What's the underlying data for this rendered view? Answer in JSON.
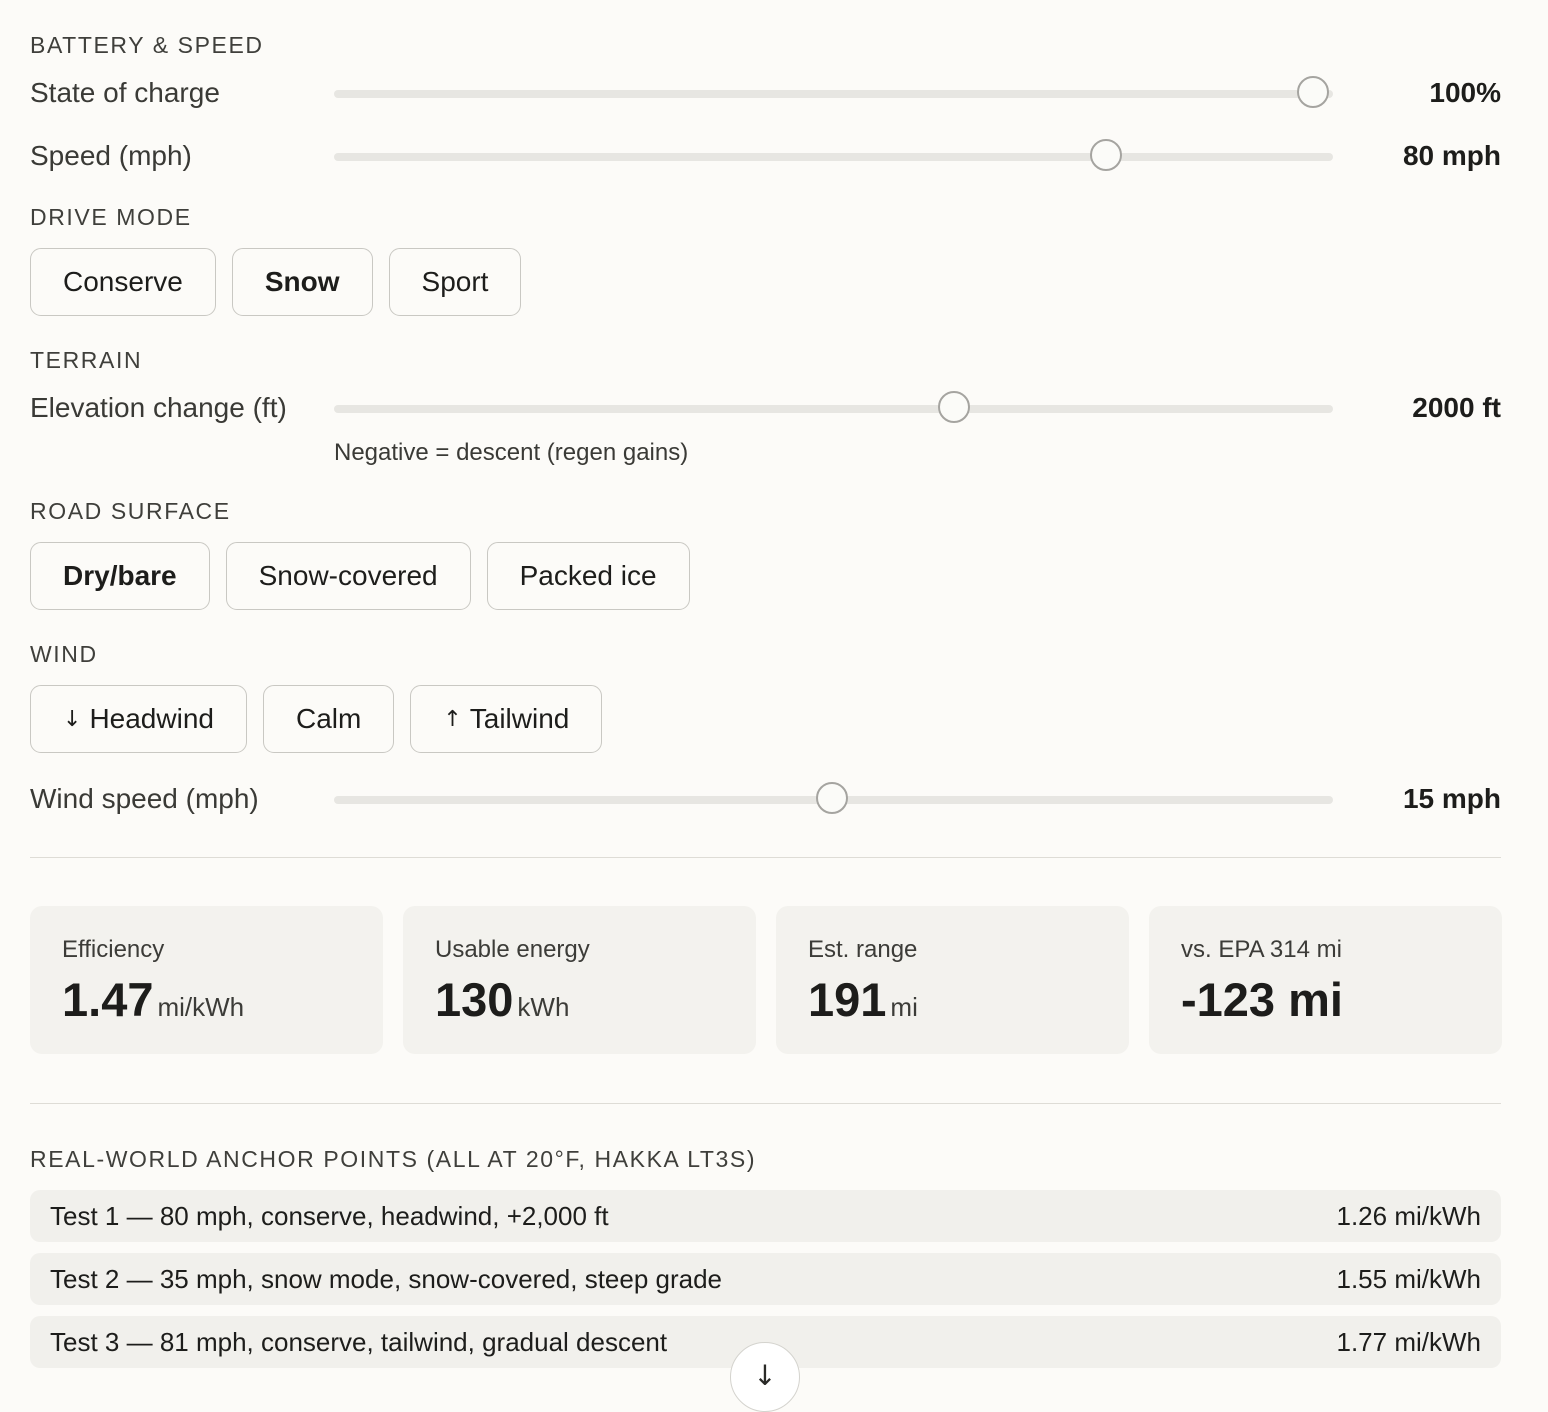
{
  "battery_speed": {
    "title": "BATTERY & SPEED",
    "state_of_charge": {
      "label": "State of charge",
      "value": "100%",
      "fraction": 1.0
    },
    "speed": {
      "label": "Speed (mph)",
      "value": "80 mph",
      "fraction": 0.775
    }
  },
  "drive_mode": {
    "title": "DRIVE MODE",
    "options": [
      "Conserve",
      "Snow",
      "Sport"
    ],
    "selected": "Snow"
  },
  "terrain": {
    "title": "TERRAIN",
    "elevation": {
      "label": "Elevation change (ft)",
      "value": "2000 ft",
      "fraction": 0.62
    },
    "hint": "Negative = descent (regen gains)"
  },
  "road_surface": {
    "title": "ROAD SURFACE",
    "options": [
      "Dry/bare",
      "Snow-covered",
      "Packed ice"
    ],
    "selected": "Dry/bare"
  },
  "wind": {
    "title": "WIND",
    "options": [
      {
        "arrow": "↓",
        "label": "Headwind",
        "icon": "arrow-down-icon"
      },
      {
        "arrow": "",
        "label": "Calm",
        "icon": ""
      },
      {
        "arrow": "↑",
        "label": "Tailwind",
        "icon": "arrow-up-icon"
      }
    ],
    "speed": {
      "label": "Wind speed (mph)",
      "value": "15 mph",
      "fraction": 0.5
    }
  },
  "metrics": [
    {
      "label": "Efficiency",
      "value": "1.47",
      "unit": "mi/kWh"
    },
    {
      "label": "Usable energy",
      "value": "130",
      "unit": "kWh"
    },
    {
      "label": "Est. range",
      "value": "191",
      "unit": "mi"
    },
    {
      "label": "vs. EPA 314 mi",
      "value": "-123 mi",
      "unit": ""
    }
  ],
  "anchors": {
    "title": "REAL-WORLD ANCHOR POINTS (ALL AT 20°F, HAKKA LT3S)",
    "items": [
      {
        "desc": "Test 1 — 80 mph, conserve, headwind, +2,000 ft",
        "value": "1.26 mi/kWh"
      },
      {
        "desc": "Test 2 — 35 mph, snow mode, snow-covered, steep grade",
        "value": "1.55 mi/kWh"
      },
      {
        "desc": "Test 3 — 81 mph, conserve, tailwind, gradual descent",
        "value": "1.77 mi/kWh"
      }
    ]
  },
  "scroll_button": {
    "icon": "arrow-down-icon",
    "glyph": "↓"
  }
}
